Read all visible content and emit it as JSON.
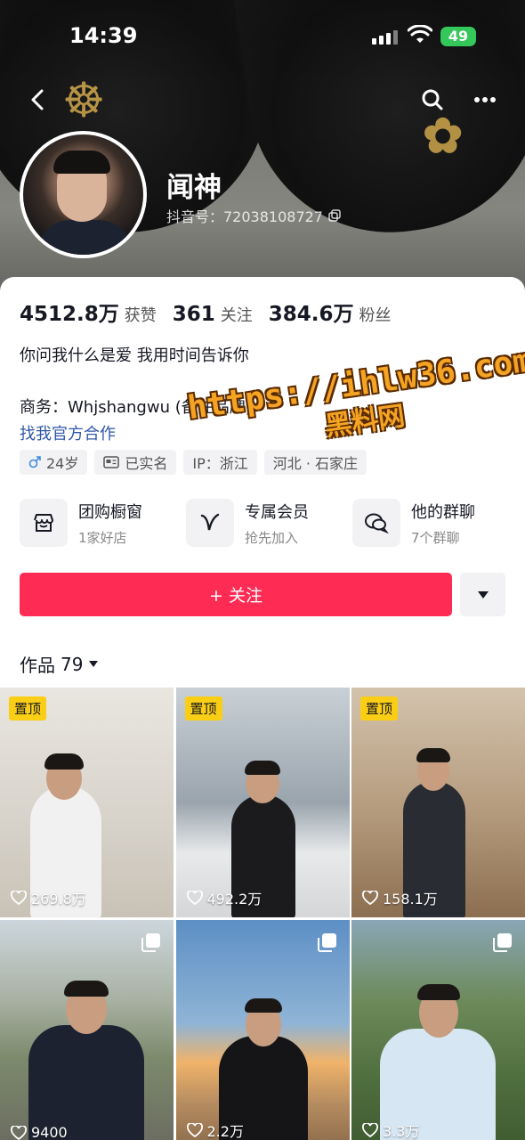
{
  "status_bar": {
    "time": "14:39",
    "battery": "49"
  },
  "profile": {
    "name": "闻神",
    "douyin_id": "抖音号：72038108727",
    "stats": [
      {
        "value": "4512.8万",
        "label": "获赞"
      },
      {
        "value": "361",
        "label": "关注"
      },
      {
        "value": "384.6万",
        "label": "粉丝"
      }
    ],
    "bio": "你问我什么是爱 我用时间告诉你",
    "business": "商务：Whjshangwu (备注品牌)",
    "cooperation_link": "找我官方合作",
    "tags": [
      {
        "icon": "male-icon",
        "text": "24岁"
      },
      {
        "icon": "id-card-icon",
        "text": "已实名"
      },
      {
        "icon": "",
        "text": "IP：浙江"
      },
      {
        "icon": "",
        "text": "河北 · 石家庄"
      }
    ]
  },
  "watermark": {
    "url": "https://ihlw36.com",
    "caption": "黑料网"
  },
  "features": [
    {
      "icon": "shop-window-icon",
      "title": "团购橱窗",
      "subtitle": "1家好店"
    },
    {
      "icon": "vip-icon",
      "title": "专属会员",
      "subtitle": "抢先加入"
    },
    {
      "icon": "chat-bubbles-icon",
      "title": "他的群聊",
      "subtitle": "7个群聊"
    }
  ],
  "follow_button": "+ 关注",
  "works": {
    "label": "作品",
    "count": "79"
  },
  "videos": [
    {
      "pinned": "置顶",
      "likes": "269.8万",
      "bg": "#d8d4cc"
    },
    {
      "pinned": "置顶",
      "likes": "492.2万",
      "bg": "#9aa4ad"
    },
    {
      "pinned": "置顶",
      "likes": "158.1万",
      "bg": "#b49a7c"
    },
    {
      "pinned": "",
      "likes": "9400",
      "bg": "#8fa0a6"
    },
    {
      "pinned": "",
      "likes": "2.2万",
      "bg": "#7f9fbf"
    },
    {
      "pinned": "",
      "likes": "3.3万",
      "bg": "#6c8a5a"
    }
  ]
}
